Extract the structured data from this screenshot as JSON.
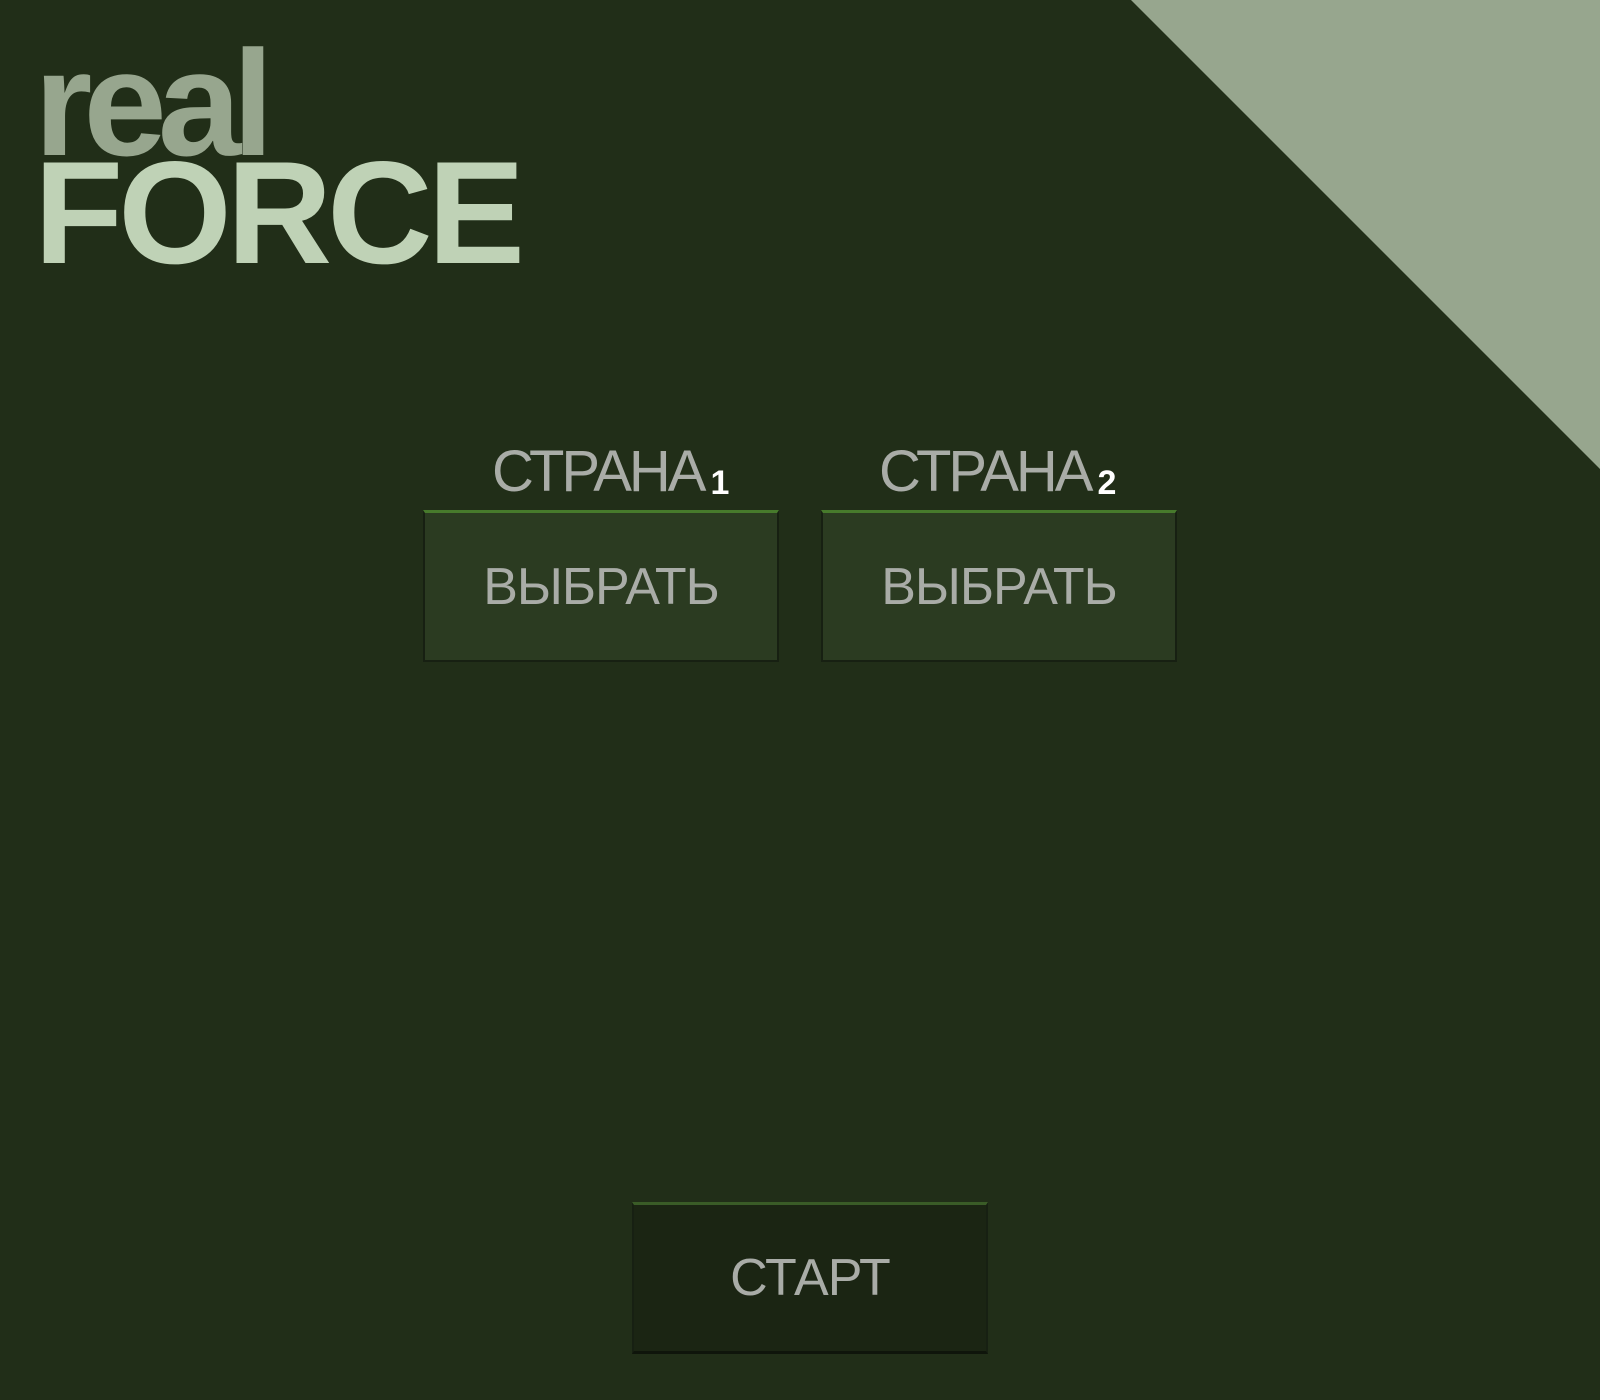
{
  "logo": {
    "line1": "real",
    "line2": "FORCE"
  },
  "countries": [
    {
      "label": "СТРАНА",
      "number": "1",
      "button_label": "ВЫБРАТЬ"
    },
    {
      "label": "СТРАНА",
      "number": "2",
      "button_label": "ВЫБРАТЬ"
    }
  ],
  "start": {
    "label": "СТАРТ"
  },
  "colors": {
    "background": "#212e18",
    "corner_triangle": "#97a68e",
    "logo_top": "#97a68e",
    "logo_bottom": "#bfd2b6",
    "text": "#a9aca7",
    "number": "#ffffff",
    "select_button": "#2b3b21",
    "start_button": "#1b2513"
  }
}
